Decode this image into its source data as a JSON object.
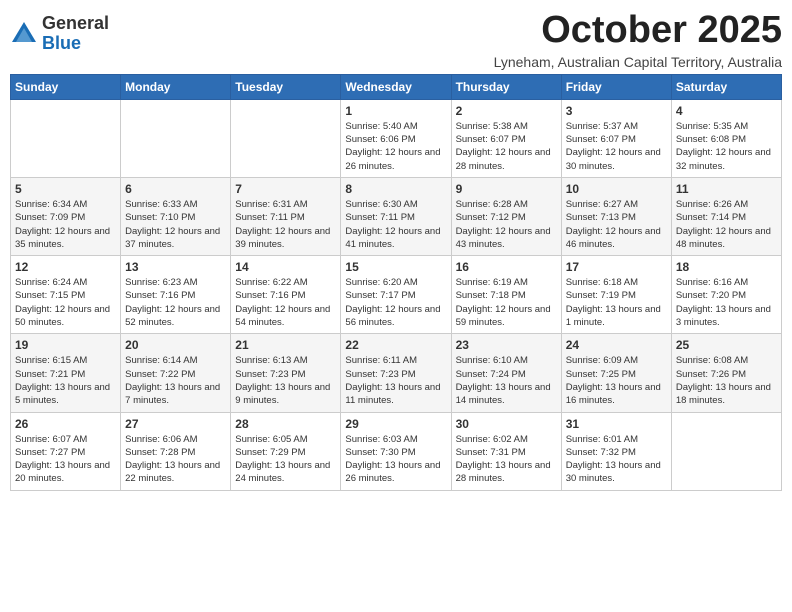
{
  "logo": {
    "general": "General",
    "blue": "Blue"
  },
  "header": {
    "month_title": "October 2025",
    "subtitle": "Lyneham, Australian Capital Territory, Australia"
  },
  "weekdays": [
    "Sunday",
    "Monday",
    "Tuesday",
    "Wednesday",
    "Thursday",
    "Friday",
    "Saturday"
  ],
  "weeks": [
    [
      {
        "day": "",
        "info": ""
      },
      {
        "day": "",
        "info": ""
      },
      {
        "day": "",
        "info": ""
      },
      {
        "day": "1",
        "info": "Sunrise: 5:40 AM\nSunset: 6:06 PM\nDaylight: 12 hours\nand 26 minutes."
      },
      {
        "day": "2",
        "info": "Sunrise: 5:38 AM\nSunset: 6:07 PM\nDaylight: 12 hours\nand 28 minutes."
      },
      {
        "day": "3",
        "info": "Sunrise: 5:37 AM\nSunset: 6:07 PM\nDaylight: 12 hours\nand 30 minutes."
      },
      {
        "day": "4",
        "info": "Sunrise: 5:35 AM\nSunset: 6:08 PM\nDaylight: 12 hours\nand 32 minutes."
      }
    ],
    [
      {
        "day": "5",
        "info": "Sunrise: 6:34 AM\nSunset: 7:09 PM\nDaylight: 12 hours\nand 35 minutes."
      },
      {
        "day": "6",
        "info": "Sunrise: 6:33 AM\nSunset: 7:10 PM\nDaylight: 12 hours\nand 37 minutes."
      },
      {
        "day": "7",
        "info": "Sunrise: 6:31 AM\nSunset: 7:11 PM\nDaylight: 12 hours\nand 39 minutes."
      },
      {
        "day": "8",
        "info": "Sunrise: 6:30 AM\nSunset: 7:11 PM\nDaylight: 12 hours\nand 41 minutes."
      },
      {
        "day": "9",
        "info": "Sunrise: 6:28 AM\nSunset: 7:12 PM\nDaylight: 12 hours\nand 43 minutes."
      },
      {
        "day": "10",
        "info": "Sunrise: 6:27 AM\nSunset: 7:13 PM\nDaylight: 12 hours\nand 46 minutes."
      },
      {
        "day": "11",
        "info": "Sunrise: 6:26 AM\nSunset: 7:14 PM\nDaylight: 12 hours\nand 48 minutes."
      }
    ],
    [
      {
        "day": "12",
        "info": "Sunrise: 6:24 AM\nSunset: 7:15 PM\nDaylight: 12 hours\nand 50 minutes."
      },
      {
        "day": "13",
        "info": "Sunrise: 6:23 AM\nSunset: 7:16 PM\nDaylight: 12 hours\nand 52 minutes."
      },
      {
        "day": "14",
        "info": "Sunrise: 6:22 AM\nSunset: 7:16 PM\nDaylight: 12 hours\nand 54 minutes."
      },
      {
        "day": "15",
        "info": "Sunrise: 6:20 AM\nSunset: 7:17 PM\nDaylight: 12 hours\nand 56 minutes."
      },
      {
        "day": "16",
        "info": "Sunrise: 6:19 AM\nSunset: 7:18 PM\nDaylight: 12 hours\nand 59 minutes."
      },
      {
        "day": "17",
        "info": "Sunrise: 6:18 AM\nSunset: 7:19 PM\nDaylight: 13 hours\nand 1 minute."
      },
      {
        "day": "18",
        "info": "Sunrise: 6:16 AM\nSunset: 7:20 PM\nDaylight: 13 hours\nand 3 minutes."
      }
    ],
    [
      {
        "day": "19",
        "info": "Sunrise: 6:15 AM\nSunset: 7:21 PM\nDaylight: 13 hours\nand 5 minutes."
      },
      {
        "day": "20",
        "info": "Sunrise: 6:14 AM\nSunset: 7:22 PM\nDaylight: 13 hours\nand 7 minutes."
      },
      {
        "day": "21",
        "info": "Sunrise: 6:13 AM\nSunset: 7:23 PM\nDaylight: 13 hours\nand 9 minutes."
      },
      {
        "day": "22",
        "info": "Sunrise: 6:11 AM\nSunset: 7:23 PM\nDaylight: 13 hours\nand 11 minutes."
      },
      {
        "day": "23",
        "info": "Sunrise: 6:10 AM\nSunset: 7:24 PM\nDaylight: 13 hours\nand 14 minutes."
      },
      {
        "day": "24",
        "info": "Sunrise: 6:09 AM\nSunset: 7:25 PM\nDaylight: 13 hours\nand 16 minutes."
      },
      {
        "day": "25",
        "info": "Sunrise: 6:08 AM\nSunset: 7:26 PM\nDaylight: 13 hours\nand 18 minutes."
      }
    ],
    [
      {
        "day": "26",
        "info": "Sunrise: 6:07 AM\nSunset: 7:27 PM\nDaylight: 13 hours\nand 20 minutes."
      },
      {
        "day": "27",
        "info": "Sunrise: 6:06 AM\nSunset: 7:28 PM\nDaylight: 13 hours\nand 22 minutes."
      },
      {
        "day": "28",
        "info": "Sunrise: 6:05 AM\nSunset: 7:29 PM\nDaylight: 13 hours\nand 24 minutes."
      },
      {
        "day": "29",
        "info": "Sunrise: 6:03 AM\nSunset: 7:30 PM\nDaylight: 13 hours\nand 26 minutes."
      },
      {
        "day": "30",
        "info": "Sunrise: 6:02 AM\nSunset: 7:31 PM\nDaylight: 13 hours\nand 28 minutes."
      },
      {
        "day": "31",
        "info": "Sunrise: 6:01 AM\nSunset: 7:32 PM\nDaylight: 13 hours\nand 30 minutes."
      },
      {
        "day": "",
        "info": ""
      }
    ]
  ]
}
